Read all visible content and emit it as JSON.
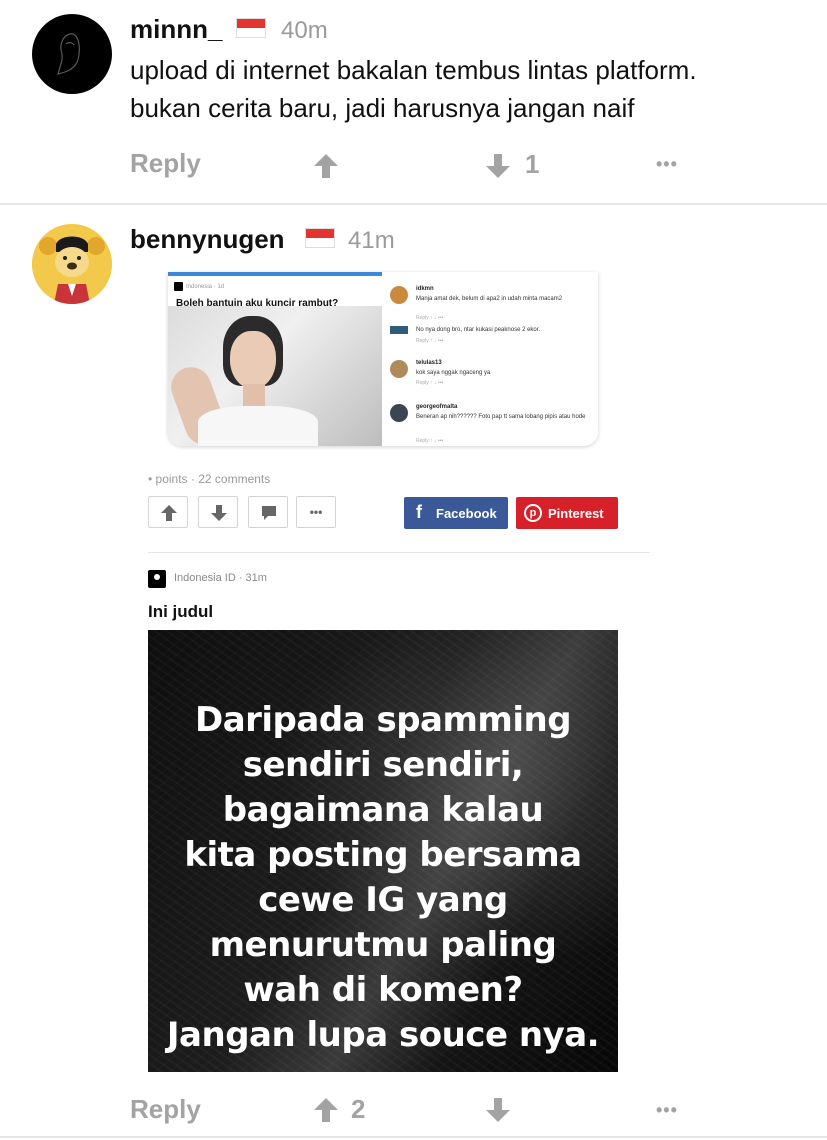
{
  "comments": [
    {
      "username": "minnn_",
      "time": "40m",
      "lines": [
        "upload di internet bakalan tembus lintas platform.",
        "bukan cerita baru, jadi harusnya jangan naif"
      ],
      "reply_label": "Reply",
      "upvotes": "",
      "downvotes": "1",
      "more_label": "•••"
    },
    {
      "username": "bennynugen",
      "time": "41m",
      "reply_label": "Reply",
      "upvotes": "2",
      "downvotes": "",
      "more_label": "•••"
    }
  ],
  "embed": {
    "mini_post": {
      "source": "Indonesia · 1d",
      "title": "Boleh bantuin aku kuncir rambut?"
    },
    "mini_comments": [
      {
        "name": "idkmn",
        "body": "Manja amat dek, belum di apa2 in udah minta macam2",
        "actions": "Reply    ↑    ↓    •••"
      },
      {
        "name": "",
        "body": "No nya dong bro, ntar kukasi peaknose 2 ekor.",
        "actions": "Reply    ↑    ↓    •••"
      },
      {
        "name": "telulas13",
        "body": "kok saya nggak ngaceng ya",
        "actions": "Reply    ↑    ↓    •••"
      },
      {
        "name": "georgeofmalta",
        "body": "Beneran ap nih?????? Foto pap tt sama lobang pipis atau hode",
        "actions": "Reply    ↑    ↓    •••"
      }
    ],
    "meta": "• points · 22 comments",
    "share": {
      "more_label": "•••",
      "facebook_label": "Facebook",
      "pinterest_label": "Pinterest"
    },
    "post": {
      "source": "Indonesia ID · 31m",
      "title": "Ini judul",
      "image_lines": [
        "Daripada spamming",
        "sendiri sendiri,",
        "bagaimana kalau",
        "kita posting bersama",
        "cewe IG yang",
        "menurutmu paling",
        "wah di komen?",
        "Jangan lupa souce nya."
      ]
    }
  },
  "colors": {
    "accent_blue": "#3b88d8",
    "facebook": "#3b5998",
    "pinterest": "#d6212a",
    "muted": "#a3a3a3",
    "flag_red": "#e3342f"
  }
}
